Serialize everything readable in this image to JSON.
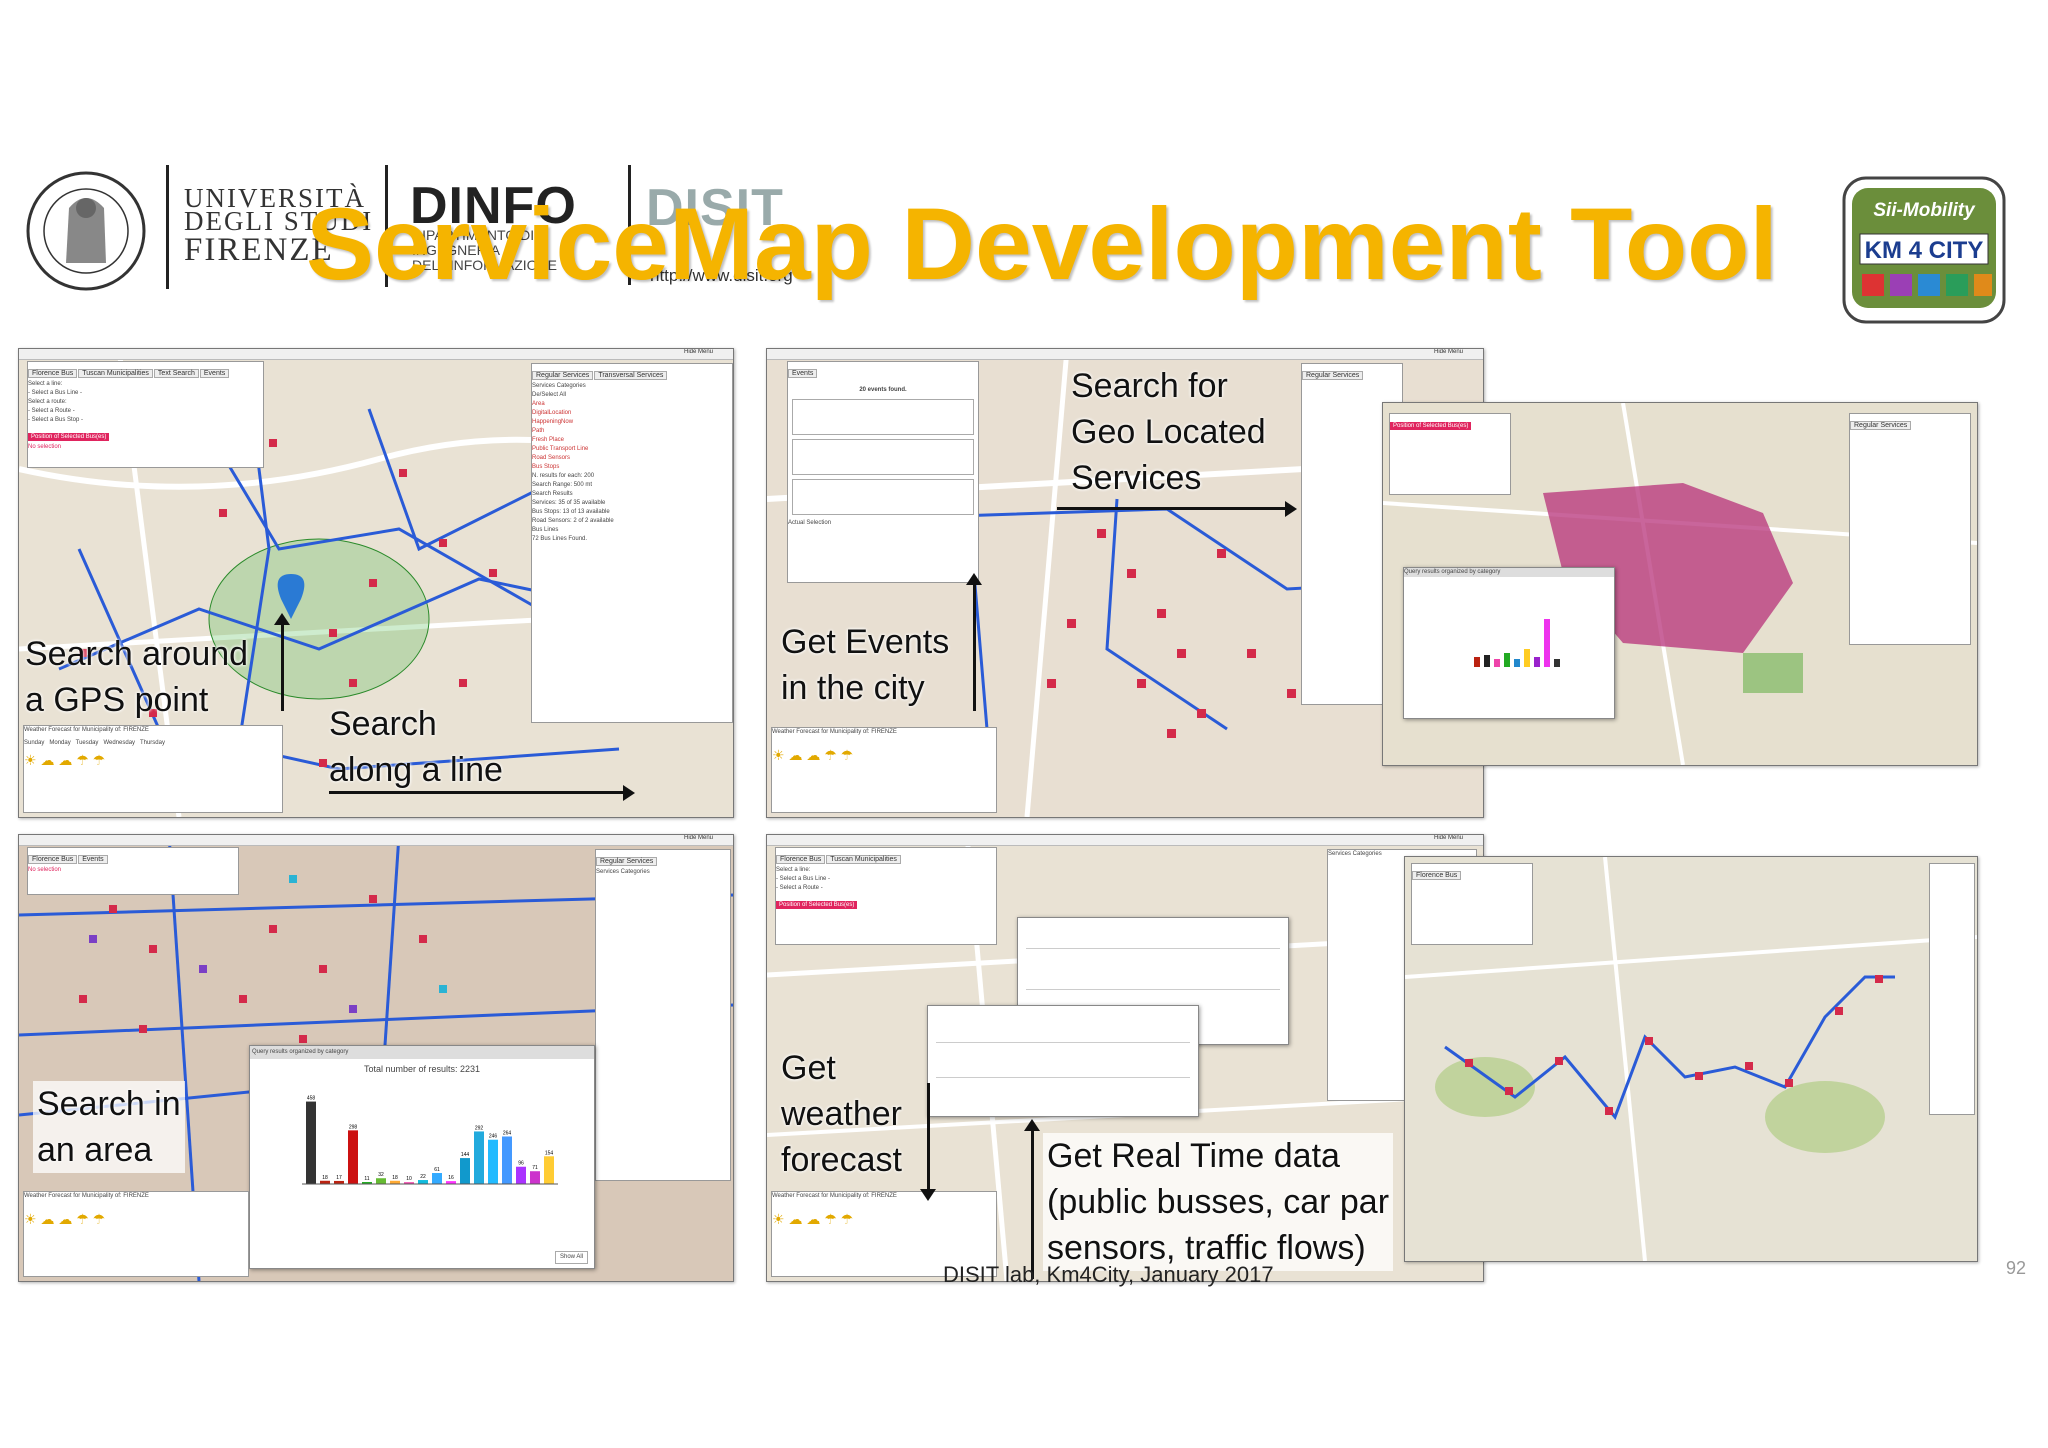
{
  "header": {
    "university_lines": [
      "UNIVERSITÀ",
      "DEGLI STUDI",
      "FIRENZE"
    ],
    "dinfo": "DINFO",
    "dinfo_sub": "DIPARTIMENTO DI INGEGNERIA DELL'INFORMAZIONE",
    "disit": "DISIT",
    "disit_url": "http://www.disit.org",
    "title": "ServiceMap Development Tool",
    "km4city_top": "Sii-Mobility",
    "km4city_brand": "KM 4 CITY"
  },
  "panels": {
    "ui": {
      "hide_menu": "Hide Menu",
      "tabs_left": [
        "Florence Bus",
        "Tuscan Municipalities",
        "Text Search",
        "Events"
      ],
      "tabs_right": [
        "Regular Services",
        "Transversal Services"
      ],
      "select_line": "Select a line:",
      "select_bus_line": "- Select a Bus Line -",
      "select_route": "Select a route:",
      "select_route_opt": "- Select a Route -",
      "select_stop": "Select a bus stop:",
      "select_stop_opt": "- Select a Bus Stop -",
      "position_btn": "Position of Selected Bus(es)",
      "actual_selection": "Actual Selection",
      "no_selection": "No selection",
      "services_categories": "Services Categories",
      "deselect_all": "De/Select All",
      "categories": [
        "Area",
        "DigitalLocation",
        "HappeningNow",
        "Path",
        "Fresh Place",
        "Public Transport Line",
        "Road Sensors",
        "Bus Stops"
      ],
      "n_results": "N. results for each:",
      "n_results_val": "200",
      "search_range": "Search Range:",
      "search_range_val": "500 mt",
      "search_results": "Search Results",
      "services_found": "Services: 35 of 35 available",
      "bus_stops_found": "Bus Stops: 13 of 13 available",
      "road_sensors_found": "Road Sensors: 2 of 2 available",
      "bus_lines": "Bus Lines",
      "bus_lines_found": "72 Bus Lines Found.",
      "weather_title": "Weather Forecast for Municipality of: FIRENZE",
      "weather_days": [
        "Sunday",
        "Monday",
        "Tuesday",
        "Wednesday",
        "Thursday"
      ],
      "events_found": "20 events found.",
      "query_results_title": "Query results organized by category",
      "total_results": "Total number of results: 2231",
      "show_all": "Show All"
    },
    "labels": {
      "gps": [
        "Search around",
        "a GPS point"
      ],
      "line": [
        "Search",
        "along a line"
      ],
      "events": [
        "Get Events",
        "in the city"
      ],
      "geo": [
        "Search for",
        "Geo Located",
        "Services"
      ],
      "area": [
        "Search in",
        "an area"
      ],
      "weather": [
        "Get",
        "weather",
        "forecast"
      ],
      "realtime": [
        "Get Real Time data",
        "(public busses, car par",
        "sensors, traffic flows)"
      ]
    },
    "chart_bar_values": [
      458,
      18,
      17,
      298,
      11,
      32,
      18,
      10,
      22,
      61,
      16,
      144,
      292,
      246,
      264,
      96,
      71,
      154
    ]
  },
  "footer": {
    "credit": "DISIT lab, Km4City, January 2017",
    "page": "92"
  },
  "colors": {
    "title": "#f5b400",
    "bus_lines": "#2a5bd7",
    "markers": "#d42a4a",
    "map_bg": "#e9e2d4"
  }
}
